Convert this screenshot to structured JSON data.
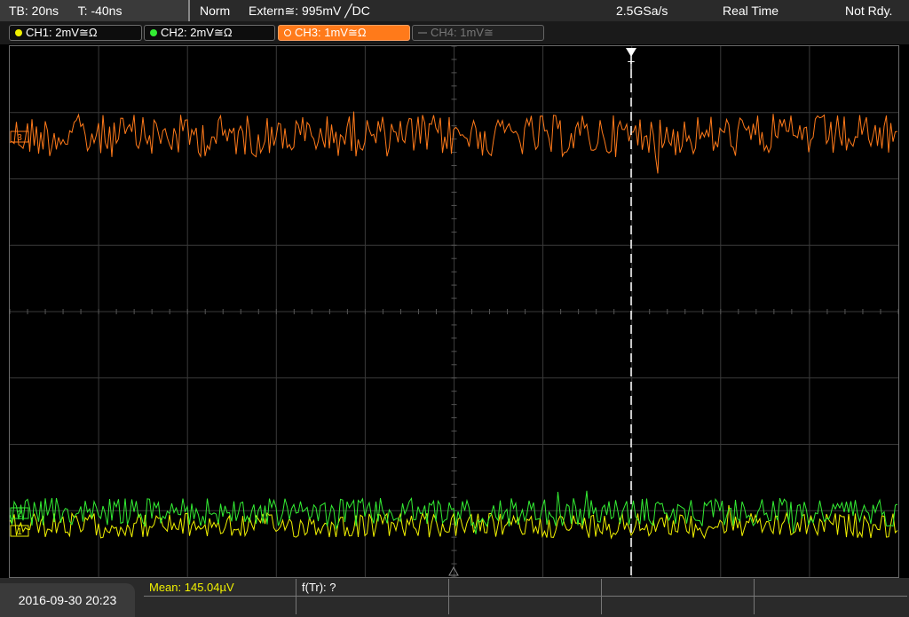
{
  "topbar": {
    "timebase": "TB: 20ns",
    "trigger_offset": "T: -40ns",
    "mode": "Norm",
    "trigger_source": "Extern≅: 995mV ╱DC",
    "sample_rate": "2.5GSa/s",
    "acq_mode": "Real Time",
    "status": "Not Rdy."
  },
  "channels": [
    {
      "label": "CH1: 2mV≅Ω",
      "color": "#f0f000",
      "active": true
    },
    {
      "label": "CH2: 2mV≅Ω",
      "color": "#33ee33",
      "active": true
    },
    {
      "label": "CH3: 1mV≅Ω",
      "color": "#ff7a1a",
      "active": true,
      "selected": true
    },
    {
      "label": "CH4: 1mV≅",
      "color": "#555555",
      "active": false
    }
  ],
  "markers": {
    "trigger": "T",
    "ch3": "3",
    "ch2": "2",
    "ch1": "1"
  },
  "bottombar": {
    "datetime": "2016-09-30 20:23",
    "mean": "Mean: 145.04µV",
    "freq": "f(Tr): ?"
  },
  "colors": {
    "ch1": "#f0f000",
    "ch2": "#33ee33",
    "ch3": "#ff7a1a",
    "grid": "#3a3a3a",
    "background": "#000000"
  }
}
